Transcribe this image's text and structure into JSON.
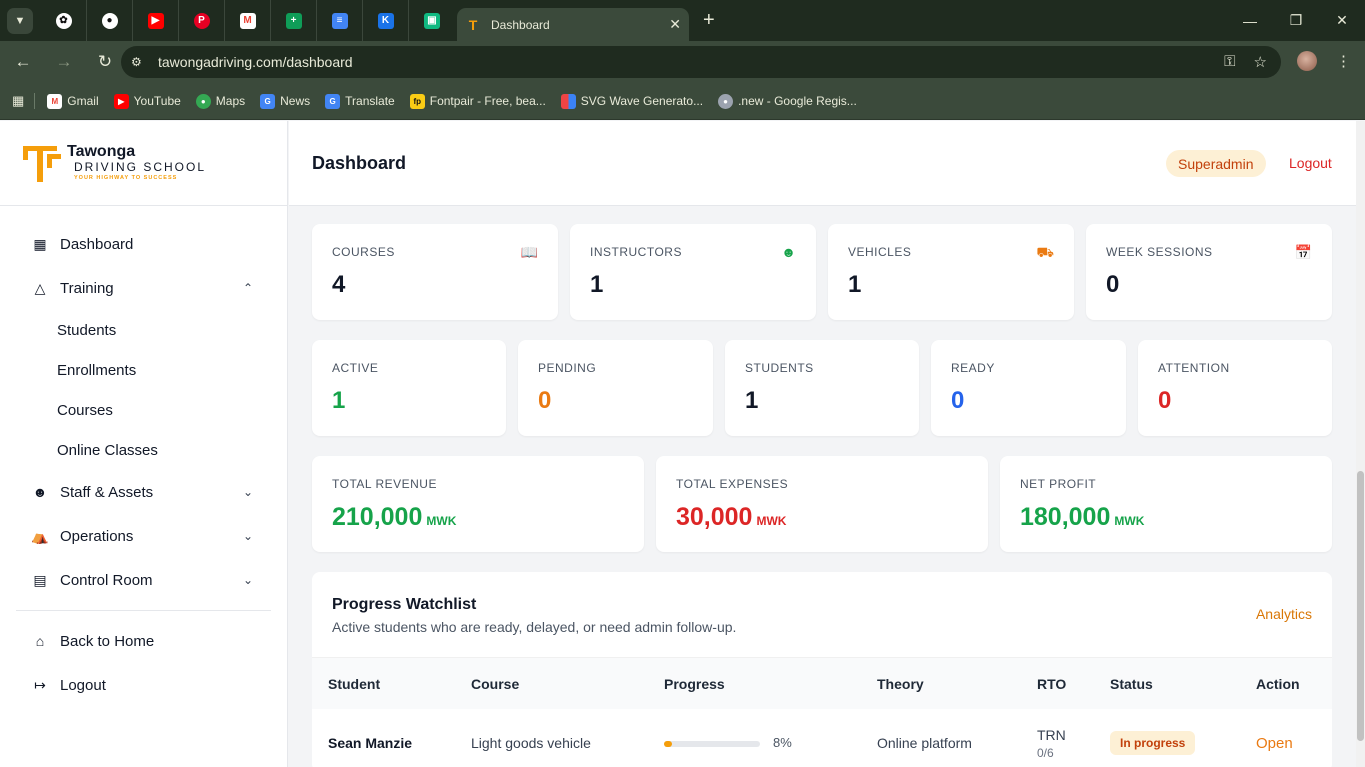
{
  "browser": {
    "active_tab_title": "Dashboard",
    "url": "tawongadriving.com/dashboard",
    "bookmarks": [
      "Gmail",
      "YouTube",
      "Maps",
      "News",
      "Translate",
      "Fontpair - Free, bea...",
      "SVG Wave Generato...",
      ".new - Google Regis..."
    ]
  },
  "brand": {
    "name": "Tawonga",
    "subtitle": "DRIVING SCHOOL",
    "tagline": "YOUR HIGHWAY TO SUCCESS",
    "accent": "#f59e0b"
  },
  "sidebar": {
    "dashboard": "Dashboard",
    "training": "Training",
    "training_items": [
      "Students",
      "Enrollments",
      "Courses",
      "Online Classes"
    ],
    "staff_assets": "Staff & Assets",
    "operations": "Operations",
    "control_room": "Control Room",
    "back_home": "Back to Home",
    "logout": "Logout"
  },
  "header": {
    "title": "Dashboard",
    "role": "Superadmin",
    "logout": "Logout"
  },
  "stats_row1": [
    {
      "label": "COURSES",
      "value": "4",
      "icon": "book-icon"
    },
    {
      "label": "INSTRUCTORS",
      "value": "1",
      "icon": "users-icon"
    },
    {
      "label": "VEHICLES",
      "value": "1",
      "icon": "car-icon"
    },
    {
      "label": "WEEK SESSIONS",
      "value": "0",
      "icon": "calendar-icon"
    }
  ],
  "stats_row2": [
    {
      "label": "ACTIVE",
      "value": "1",
      "color": "#16a34a"
    },
    {
      "label": "PENDING",
      "value": "0",
      "color": "#ea7a12"
    },
    {
      "label": "STUDENTS",
      "value": "1",
      "color": "#111827"
    },
    {
      "label": "READY",
      "value": "0",
      "color": "#2563eb"
    },
    {
      "label": "ATTENTION",
      "value": "0",
      "color": "#dc2626"
    }
  ],
  "finance": [
    {
      "label": "TOTAL REVENUE",
      "value": "210,000",
      "unit": "MWK",
      "color": "#16a34a"
    },
    {
      "label": "TOTAL EXPENSES",
      "value": "30,000",
      "unit": "MWK",
      "color": "#dc2626"
    },
    {
      "label": "NET PROFIT",
      "value": "180,000",
      "unit": "MWK",
      "color": "#16a34a"
    }
  ],
  "watchlist": {
    "title": "Progress Watchlist",
    "subtitle": "Active students who are ready, delayed, or need admin follow-up.",
    "analytics": "Analytics",
    "columns": [
      "Student",
      "Course",
      "Progress",
      "Theory",
      "RTO",
      "Status",
      "Action"
    ],
    "rows": [
      {
        "student": "Sean Manzie",
        "course": "Light goods vehicle",
        "progress": 0.08,
        "progress_label": "8%",
        "theory": "Online platform",
        "rto": "TRN",
        "rto_sub": "0/6",
        "status": "In progress",
        "action": "Open"
      }
    ]
  }
}
